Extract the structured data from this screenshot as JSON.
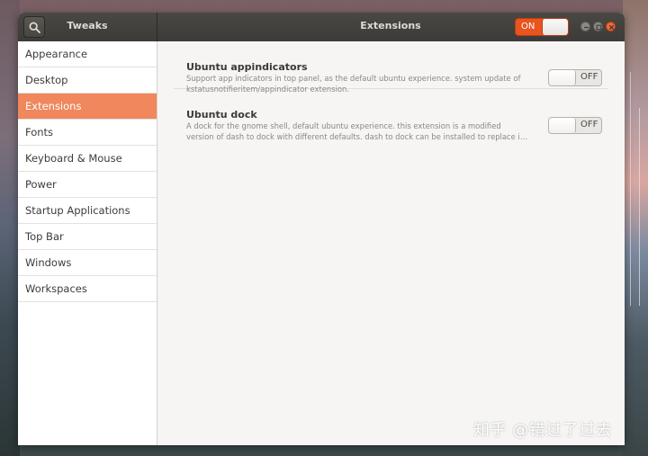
{
  "titlebar": {
    "app_title": "Tweaks",
    "page_title": "Extensions",
    "master_switch": {
      "label": "ON",
      "state": "on"
    }
  },
  "sidebar": {
    "items": [
      {
        "label": "Appearance"
      },
      {
        "label": "Desktop"
      },
      {
        "label": "Extensions",
        "active": true
      },
      {
        "label": "Fonts"
      },
      {
        "label": "Keyboard & Mouse"
      },
      {
        "label": "Power"
      },
      {
        "label": "Startup Applications"
      },
      {
        "label": "Top Bar"
      },
      {
        "label": "Windows"
      },
      {
        "label": "Workspaces"
      }
    ]
  },
  "extensions": [
    {
      "name": "Ubuntu appindicators",
      "desc_line1": "Support app indicators in top panel, as the default ubuntu experience. system update of",
      "desc_line2": "kstatusnotifieritem/appindicator extension.",
      "toggle_label": "OFF"
    },
    {
      "name": "Ubuntu dock",
      "desc_line1": "A dock for the gnome shell, default ubuntu experience. this extension is a modified",
      "desc_line2": "version of dash to dock with different defaults. dash to dock can be installed to replace i…",
      "toggle_label": "OFF"
    }
  ],
  "watermark": "知乎 @错过了过去",
  "colors": {
    "accent": "#e95420",
    "selected_row": "#f0875d",
    "titlebar": "#3c3b37"
  }
}
